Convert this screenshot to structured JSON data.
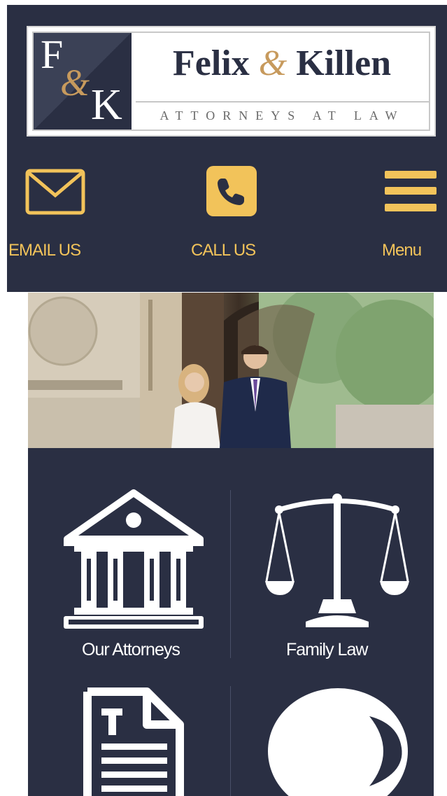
{
  "logo": {
    "monogram_first": "F",
    "monogram_amp": "&",
    "monogram_last": "K",
    "name_first": "Felix",
    "name_amp": "&",
    "name_last": "Killen",
    "tagline": "ATTORNEYS AT LAW"
  },
  "actions": {
    "email": {
      "label": "EMAIL US",
      "icon": "envelope-icon"
    },
    "call": {
      "label": "CALL US",
      "icon": "phone-icon"
    },
    "menu": {
      "label": "Menu",
      "icon": "hamburger-icon"
    }
  },
  "tiles": [
    {
      "label": "Our Attorneys",
      "icon": "courthouse-icon"
    },
    {
      "label": "Family Law",
      "icon": "scales-icon"
    },
    {
      "label": "",
      "icon": "document-icon"
    },
    {
      "label": "",
      "icon": "moon-icon"
    }
  ],
  "colors": {
    "navy": "#2a2f43",
    "gold": "#f2c35a",
    "copper": "#c79a5d",
    "white": "#ffffff"
  }
}
